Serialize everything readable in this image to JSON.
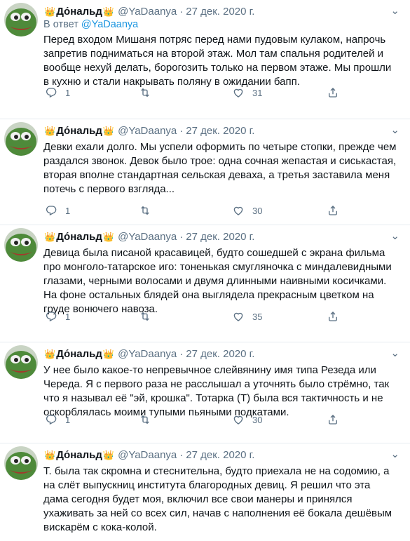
{
  "tweets": [
    {
      "author": "До́нальд",
      "crown_left": "👑",
      "crown_right": "👑",
      "handle": "@YaDaanya",
      "dot": "·",
      "date": "27 дек. 2020 г.",
      "reply_prefix": "В ответ",
      "reply_handle": "@YaDaanya",
      "text": "Перед входом Мишаня потряс перед нами пудовым кулаком, напрочь запретив подниматься на второй этаж. Мол там спальня родителей и вообще нехуй делать, борогозить только на первом этаже. Мы прошли в кухню и стали накрывать поляну в ожидании бапп.",
      "replies": "1",
      "retweets": "",
      "likes": "31"
    },
    {
      "author": "До́нальд",
      "crown_left": "👑",
      "crown_right": "👑",
      "handle": "@YaDaanya",
      "dot": "·",
      "date": "27 дек. 2020 г.",
      "text": "Девки ехали долго. Мы успели оформить по четыре стопки, прежде чем раздался звонок. Девок было трое: одна сочная жепастая и сиськастая, вторая вполне стандартная сельская деваха, а третья заставила меня потечь с первого взгляда...",
      "replies": "1",
      "retweets": "",
      "likes": "30"
    },
    {
      "author": "До́нальд",
      "crown_left": "👑",
      "crown_right": "👑",
      "handle": "@YaDaanya",
      "dot": "·",
      "date": "27 дек. 2020 г.",
      "text": "Девица была писаной красавицей, будто сошедшей с экрана фильма про монголо-татарское иго: тоненькая смугляночка с миндалевидными глазами, черными волосами и двумя длинными наивными косичками. На фоне остальных блядей она выглядела прекрасным цветком на груде вонючего навоза.",
      "replies": "1",
      "retweets": "",
      "likes": "35"
    },
    {
      "author": "До́нальд",
      "crown_left": "👑",
      "crown_right": "👑",
      "handle": "@YaDaanya",
      "dot": "·",
      "date": "27 дек. 2020 г.",
      "text": "У нее было какое-то непревычное слейвянину имя типа Резеда или Череда. Я с первого раза не расслышал а уточнять было стрёмно, так что я называл её \"эй, крошка\". Тотарка (Т) была вся тактичность и не оскорблялась моими тупыми пьяными подкатами.",
      "replies": "1",
      "retweets": "",
      "likes": "30"
    },
    {
      "author": "До́нальд",
      "crown_left": "👑",
      "crown_right": "👑",
      "handle": "@YaDaanya",
      "dot": "·",
      "date": "27 дек. 2020 г.",
      "text": "Т. была так скромна и стеснительна, будто приехала не на содомию, а на слёт выпускниц института благородных девиц. Я решил что эта дама сегодня будет моя, включил все свои манеры и принялся ухаживать за ней со всех сил, начав с наполнения её бокала дешёвым вискарём с кока-колой."
    }
  ],
  "more_icon": "⌄"
}
